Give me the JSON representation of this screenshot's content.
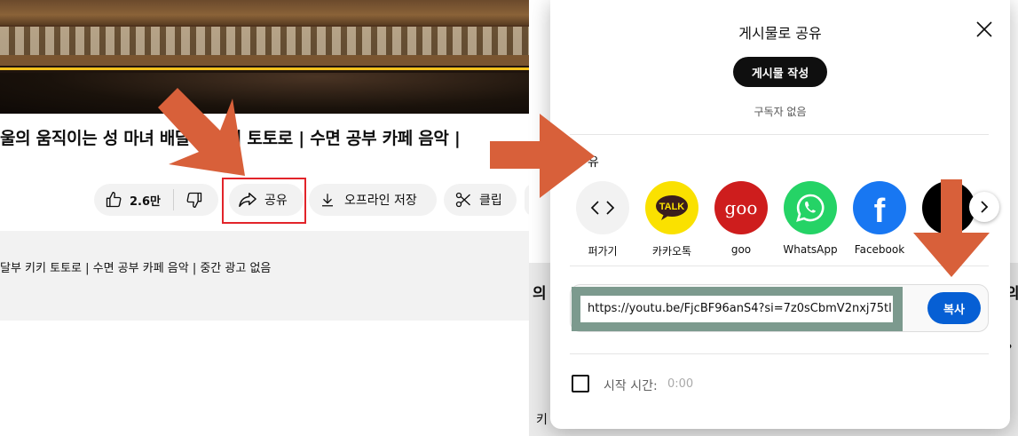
{
  "video": {
    "title": "울의 움직이는 성 마녀 배달부 키키 토토로 | 수면 공부 카페 음악 |",
    "like_count": "2.6만",
    "share_label": "공유",
    "offline_label": "오프라인 저장",
    "clip_label": "클립",
    "description": "달부 키키 토토로 | 수면 공부 카페 음악 | 중간 광고 없음"
  },
  "behind": {
    "glyph_1": "의",
    "glyph_2": "의",
    "glyph_3": "?",
    "glyph_4": "키"
  },
  "dialog": {
    "title": "게시물로 공유",
    "post_button": "게시물 작성",
    "subscribers": "구독자 없음",
    "section_label": "유",
    "share_targets": [
      {
        "label": "퍼가기",
        "icon": "embed-icon",
        "color": "#f2f2f2"
      },
      {
        "label": "카카오톡",
        "icon": "kakaotalk-icon",
        "color": "#fae100",
        "mark": "TALK"
      },
      {
        "label": "goo",
        "icon": "goo-icon",
        "color": "#ce1d1d",
        "mark": "goo"
      },
      {
        "label": "WhatsApp",
        "icon": "whatsapp-icon",
        "color": "#25d366"
      },
      {
        "label": "Facebook",
        "icon": "facebook-icon",
        "color": "#1877f2",
        "mark": "f"
      },
      {
        "label": "",
        "icon": "x-icon",
        "color": "#000000",
        "mark": "X"
      }
    ],
    "url": "https://youtu.be/FjcBF96anS4?si=7z0sCbmV2nxj75tl",
    "copy_button": "복사",
    "start_time_label": "시작 시간:",
    "start_time_value": "0:00"
  },
  "colors": {
    "annotation_arrow": "#d8603a",
    "highlight_box": "#e2242a",
    "url_highlight": "#7c9a8e",
    "copy_button": "#065fd4"
  }
}
